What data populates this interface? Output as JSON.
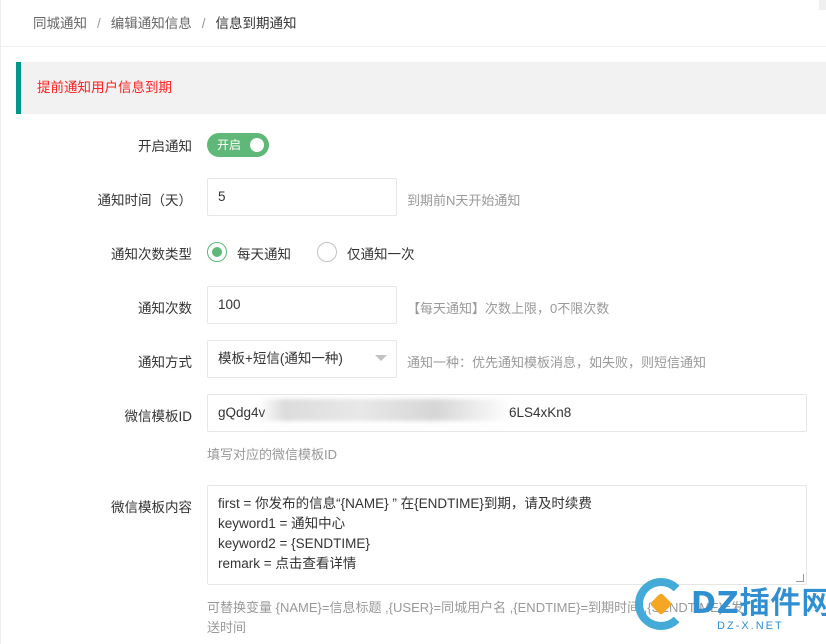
{
  "breadcrumb": {
    "items": [
      "同城通知",
      "编辑通知信息",
      "信息到期通知"
    ],
    "separator": "/"
  },
  "notice": {
    "text": "提前通知用户信息到期",
    "color": "#ff1f1f",
    "accent": "#009688"
  },
  "form": {
    "enable": {
      "label": "开启通知",
      "switch_text": "开启",
      "on": true
    },
    "notify_days": {
      "label": "通知时间（天）",
      "value": "5",
      "hint": "到期前N天开始通知"
    },
    "count_type": {
      "label": "通知次数类型",
      "options": [
        {
          "label": "每天通知",
          "checked": true
        },
        {
          "label": "仅通知一次",
          "checked": false
        }
      ]
    },
    "count": {
      "label": "通知次数",
      "value": "100",
      "hint": "【每天通知】次数上限，0不限次数"
    },
    "method": {
      "label": "通知方式",
      "selected": "模板+短信(通知一种)",
      "hint": "通知一种：优先通知模板消息，如失败，则短信通知"
    },
    "template_id": {
      "label": "微信模板ID",
      "value_start": "gQdg4v",
      "value_end": "6LS4xKn8",
      "hint": "填写对应的微信模板ID"
    },
    "template_content": {
      "label": "微信模板内容",
      "lines": [
        "first = 你发布的信息“{NAME} ” 在{ENDTIME}到期，请及时续费",
        "keyword1 =  通知中心",
        "keyword2 = {SENDTIME}",
        "remark = 点击查看详情"
      ],
      "hint_line1": "可替换变量  {NAME}=信息标题  ,{USER}=同城用户名  ,{ENDTIME}=到期时间  ,{SENDTIME}=发",
      "hint_line2": "送时间"
    }
  },
  "watermark": {
    "text": "DZ插件网",
    "sub": "DZ-X.NET"
  },
  "colors": {
    "switch_on": "#5fb878",
    "radio_on": "#5fb878",
    "hint": "#999999"
  }
}
